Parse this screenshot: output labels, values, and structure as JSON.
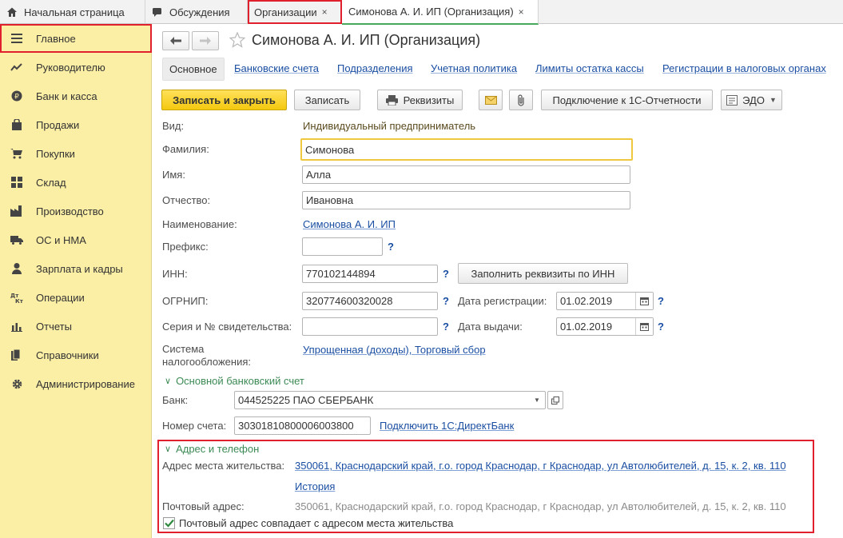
{
  "top_tabs": [
    {
      "label": "Начальная страница",
      "icon": "home-icon"
    },
    {
      "label": "Обсуждения",
      "icon": "chat-icon"
    },
    {
      "label": "Организации",
      "close": "×"
    },
    {
      "label": "Симонова А. И. ИП (Организация)",
      "close": "×"
    }
  ],
  "sidebar": {
    "items": [
      {
        "label": "Главное",
        "icon": "menu-icon"
      },
      {
        "label": "Руководителю",
        "icon": "trend-icon"
      },
      {
        "label": "Банк и касса",
        "icon": "ruble-icon"
      },
      {
        "label": "Продажи",
        "icon": "bag-icon"
      },
      {
        "label": "Покупки",
        "icon": "cart-icon"
      },
      {
        "label": "Склад",
        "icon": "warehouse-icon"
      },
      {
        "label": "Производство",
        "icon": "factory-icon"
      },
      {
        "label": "ОС и НМА",
        "icon": "truck-icon"
      },
      {
        "label": "Зарплата и кадры",
        "icon": "person-icon"
      },
      {
        "label": "Операции",
        "icon": "dt-kt-icon"
      },
      {
        "label": "Отчеты",
        "icon": "bar-chart-icon"
      },
      {
        "label": "Справочники",
        "icon": "books-icon"
      },
      {
        "label": "Администрирование",
        "icon": "gear-icon"
      }
    ]
  },
  "header": {
    "title": "Симонова А. И. ИП (Организация)"
  },
  "subtabs": [
    "Основное",
    "Банковские счета",
    "Подразделения",
    "Учетная политика",
    "Лимиты остатка кассы",
    "Регистрации в налоговых органах"
  ],
  "toolbar": {
    "save_close": "Записать и закрыть",
    "save": "Записать",
    "requisites": "Реквизиты",
    "connect": "Подключение к 1С-Отчетности",
    "edo": "ЭДО"
  },
  "form": {
    "vid_label": "Вид:",
    "vid_value": "Индивидуальный предприниматель",
    "lastname_label": "Фамилия:",
    "lastname_value": "Симонова",
    "firstname_label": "Имя:",
    "firstname_value": "Алла",
    "middlename_label": "Отчество:",
    "middlename_value": "Ивановна",
    "name_label": "Наименование:",
    "name_value": "Симонова А. И. ИП",
    "prefix_label": "Префикс:",
    "prefix_value": "",
    "inn_label": "ИНН:",
    "inn_value": "770102144894",
    "fill_by_inn": "Заполнить реквизиты по ИНН",
    "ogrnip_label": "ОГРНИП:",
    "ogrnip_value": "320774600320028",
    "reg_date_label": "Дата регистрации:",
    "reg_date_value": "01.02.2019",
    "cert_label": "Серия и № свидетельства:",
    "cert_value": "",
    "issue_date_label": "Дата выдачи:",
    "issue_date_value": "01.02.2019",
    "tax_label_1": "Система",
    "tax_label_2": "налогообложения:",
    "tax_value": "Упрощенная (доходы), Торговый сбор",
    "question": "?"
  },
  "bank_section": {
    "title": "Основной банковский счет",
    "bank_label": "Банк:",
    "bank_value": "044525225 ПАО СБЕРБАНК",
    "account_label": "Номер счета:",
    "account_value": "30301810800006003800",
    "directbank_link": "Подключить 1С:ДиректБанк"
  },
  "address_section": {
    "title": "Адрес и телефон",
    "residence_label": "Адрес места жительства:",
    "residence_value": "350061, Краснодарский край, г.о. город Краснодар, г Краснодар, ул Автолюбителей, д. 15, к. 2, кв. 110",
    "history_link": "История",
    "postal_label": "Почтовый адрес:",
    "postal_value": "350061, Краснодарский край, г.о. город Краснодар, г Краснодар, ул Автолюбителей, д. 15, к. 2, кв. 110",
    "same_address_checkbox": "Почтовый адрес совпадает с адресом места жительства",
    "same_address_checked": true
  },
  "colors": {
    "sidebar_bg": "#fbeea5",
    "highlight_red": "#e0212d",
    "primary_button": "#f5c90f",
    "link": "#1a4ea2",
    "section_green": "#3c8a55"
  }
}
